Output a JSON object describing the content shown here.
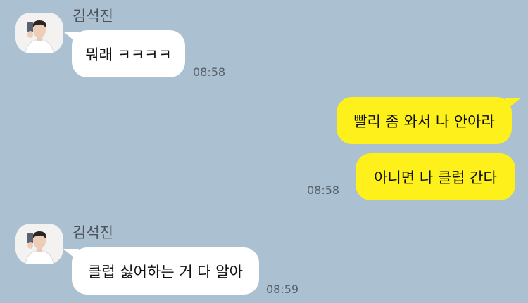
{
  "messages": [
    {
      "direction": "incoming",
      "sender": "김석진",
      "avatar": "profile-photo",
      "text": "뭐래 ㅋㅋㅋㅋ",
      "time": "08:58"
    },
    {
      "direction": "outgoing",
      "text": "빨리 좀 와서 나 안아라"
    },
    {
      "direction": "outgoing",
      "text": "아니면 나 클럽 간다",
      "time": "08:58"
    },
    {
      "direction": "incoming",
      "sender": "김석진",
      "avatar": "profile-photo",
      "text": "클럽 싫어하는 거 다 알아",
      "time": "08:59"
    }
  ],
  "colors": {
    "background": "#abc1d1",
    "incoming_bubble": "#ffffff",
    "outgoing_bubble": "#fef01b",
    "sender_text": "#4d535a",
    "time_text": "#55606b"
  }
}
